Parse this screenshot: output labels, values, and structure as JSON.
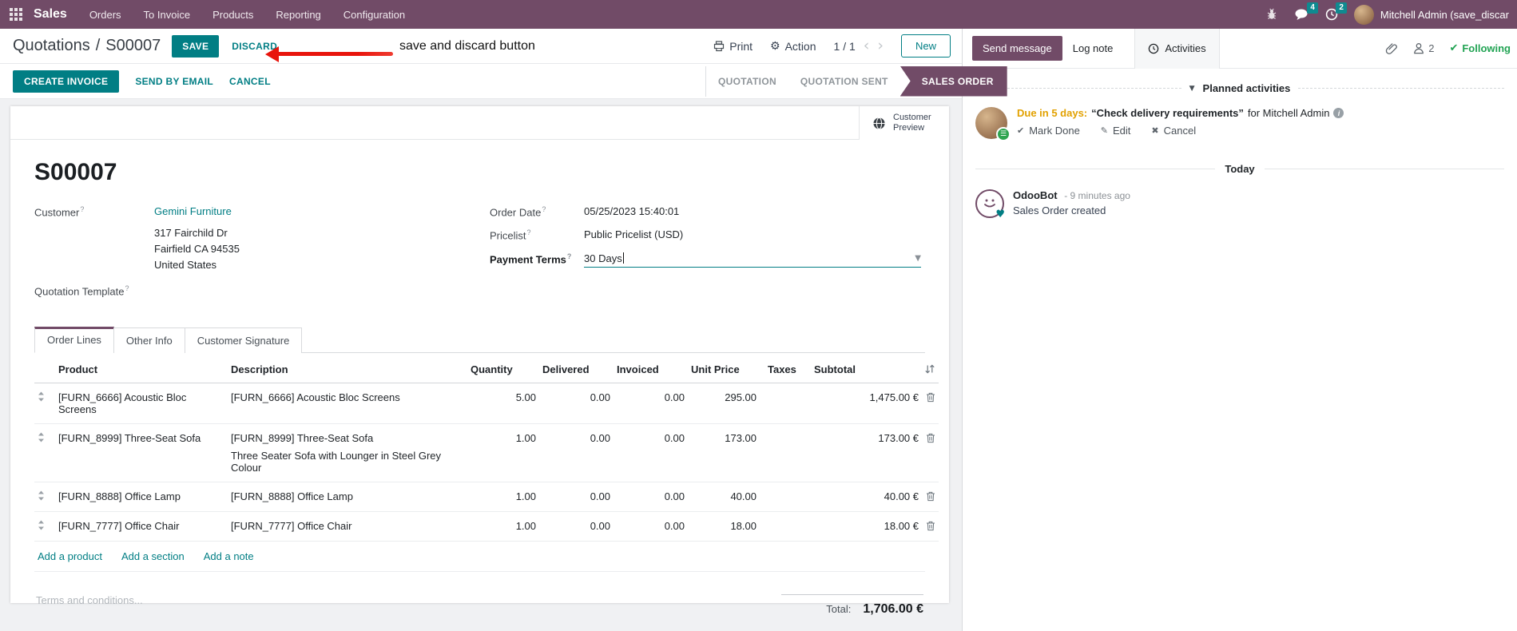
{
  "nav": {
    "app": "Sales",
    "menus": [
      "Orders",
      "To Invoice",
      "Products",
      "Reporting",
      "Configuration"
    ],
    "message_badge": "4",
    "activity_badge": "2",
    "user": "Mitchell Admin (save_discar"
  },
  "breadcrumb": {
    "parent": "Quotations",
    "separator": "/",
    "current": "S00007"
  },
  "header_actions": {
    "save": "SAVE",
    "discard": "DISCARD"
  },
  "annotation": {
    "label": "save and discard button"
  },
  "control_panel": {
    "print": "Print",
    "action": "Action",
    "pager": "1 / 1",
    "new_button": "New"
  },
  "order_actions": {
    "create_invoice": "CREATE INVOICE",
    "send_by_email": "SEND BY EMAIL",
    "cancel": "CANCEL"
  },
  "statusbar": {
    "steps": [
      "QUOTATION",
      "QUOTATION SENT",
      "SALES ORDER"
    ],
    "active": "SALES ORDER"
  },
  "sheet": {
    "customer_preview": "Customer Preview",
    "title": "S00007",
    "help_marker": "?",
    "left_fields": {
      "customer_label": "Customer",
      "customer_value": "Gemini Furniture",
      "address_line1": "317 Fairchild Dr",
      "address_line2": "Fairfield CA 94535",
      "address_line3": "United States",
      "quotation_template_label": "Quotation Template"
    },
    "right_fields": {
      "order_date_label": "Order Date",
      "order_date_value": "05/25/2023 15:40:01",
      "pricelist_label": "Pricelist",
      "pricelist_value": "Public Pricelist (USD)",
      "payment_terms_label": "Payment Terms",
      "payment_terms_value": "30 Days"
    },
    "tabs": [
      "Order Lines",
      "Other Info",
      "Customer Signature"
    ],
    "order_lines": {
      "headers": [
        "Product",
        "Description",
        "Quantity",
        "Delivered",
        "Invoiced",
        "Unit Price",
        "Taxes",
        "Subtotal"
      ],
      "rows": [
        {
          "product": "[FURN_6666] Acoustic Bloc Screens",
          "description": "[FURN_6666] Acoustic Bloc Screens",
          "description2": "",
          "quantity": "5.00",
          "delivered": "0.00",
          "invoiced": "0.00",
          "unit_price": "295.00",
          "taxes": "",
          "subtotal": "1,475.00 €"
        },
        {
          "product": "[FURN_8999] Three-Seat Sofa",
          "description": "[FURN_8999] Three-Seat Sofa",
          "description2": "Three Seater Sofa with Lounger in Steel Grey Colour",
          "quantity": "1.00",
          "delivered": "0.00",
          "invoiced": "0.00",
          "unit_price": "173.00",
          "taxes": "",
          "subtotal": "173.00 €"
        },
        {
          "product": "[FURN_8888] Office Lamp",
          "description": "[FURN_8888] Office Lamp",
          "description2": "",
          "quantity": "1.00",
          "delivered": "0.00",
          "invoiced": "0.00",
          "unit_price": "40.00",
          "taxes": "",
          "subtotal": "40.00 €"
        },
        {
          "product": "[FURN_7777] Office Chair",
          "description": "[FURN_7777] Office Chair",
          "description2": "",
          "quantity": "1.00",
          "delivered": "0.00",
          "invoiced": "0.00",
          "unit_price": "18.00",
          "taxes": "",
          "subtotal": "18.00 €"
        }
      ],
      "links": [
        "Add a product",
        "Add a section",
        "Add a note"
      ]
    },
    "footer": {
      "terms_placeholder": "Terms and conditions...",
      "total_label": "Total:",
      "total_value": "1,706.00 €"
    }
  },
  "chatter": {
    "send_message": "Send message",
    "log_note": "Log note",
    "activities": "Activities",
    "follower_count": "2",
    "following": "Following",
    "planned_header": "Planned activities",
    "activity": {
      "due": "Due in 5 days:",
      "summary": "“Check delivery requirements”",
      "assignee": "for Mitchell Admin",
      "mark_done": "Mark Done",
      "edit": "Edit",
      "cancel": "Cancel"
    },
    "today": "Today",
    "message": {
      "author": "OdooBot",
      "time": "- 9 minutes ago",
      "body": "Sales Order created"
    }
  },
  "colors": {
    "primary_purple": "#714B67",
    "accent_teal": "#017e84",
    "modified_blue": "#2e9dd8",
    "due_orange": "#e2a100",
    "success_green": "#21a353",
    "annotation_red": "#e8140c"
  }
}
